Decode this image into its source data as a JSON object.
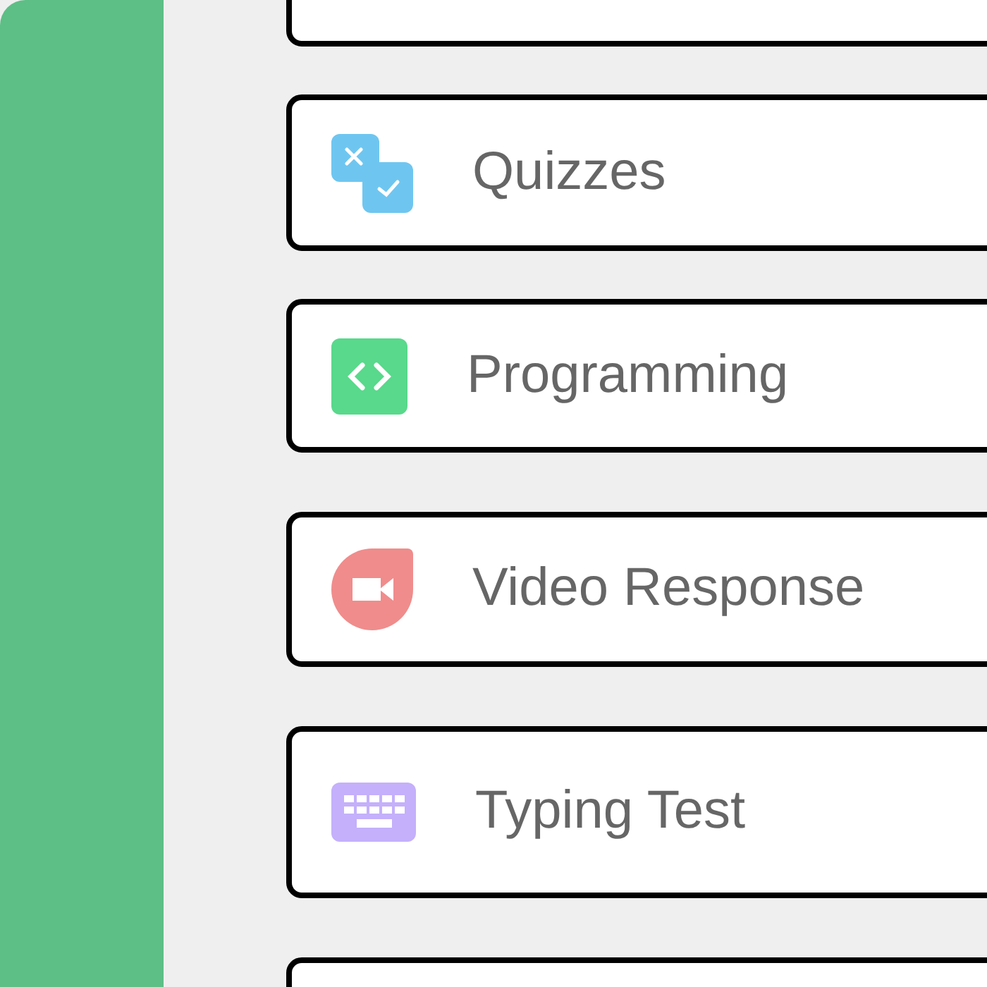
{
  "options": [
    {
      "kind": "quiz",
      "label": "Quizzes"
    },
    {
      "kind": "code",
      "label": "Programming"
    },
    {
      "kind": "video",
      "label": "Video Response"
    },
    {
      "kind": "keyboard",
      "label": "Typing Test"
    }
  ]
}
